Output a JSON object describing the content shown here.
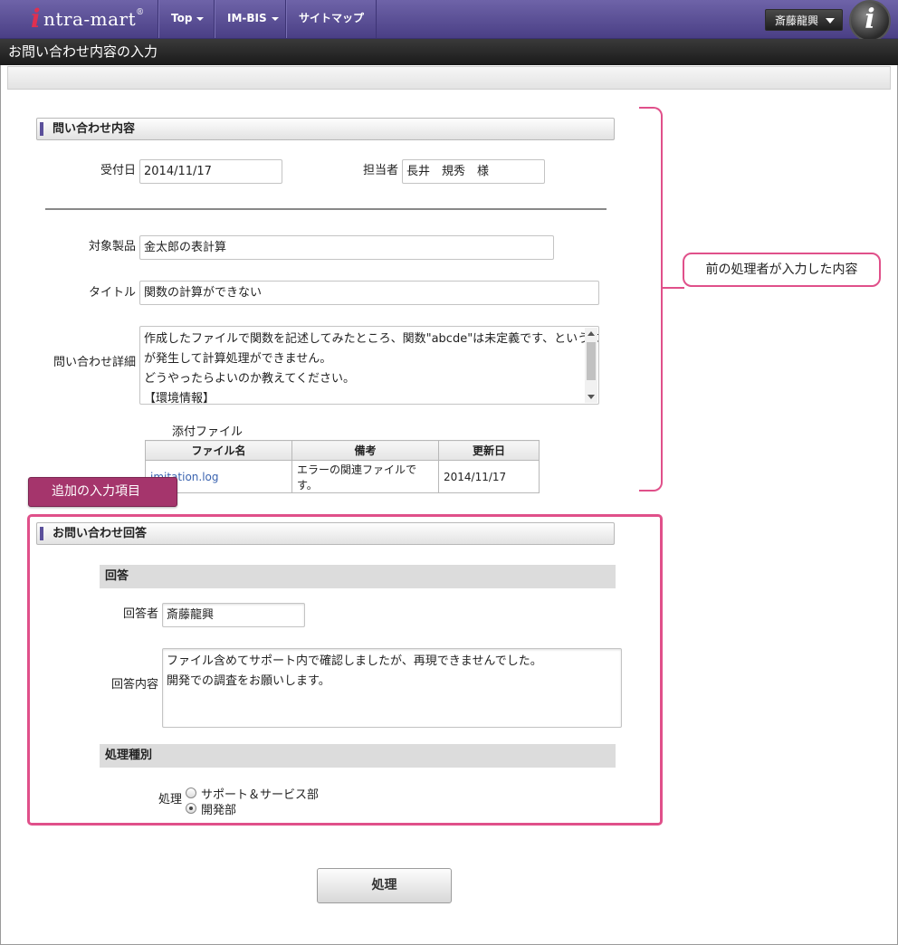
{
  "app": {
    "logo_prefix": "i",
    "logo_text": "ntra-mart",
    "logo_reg": "®",
    "nav": [
      {
        "label": "Top",
        "dropdown": true
      },
      {
        "label": "IM-BIS",
        "dropdown": true
      },
      {
        "label": "サイトマップ",
        "dropdown": false
      }
    ],
    "user": "斎藤龍興",
    "avatar_letter": "i"
  },
  "page": {
    "title": "お問い合わせ内容の入力"
  },
  "inquiry": {
    "heading": "問い合わせ内容",
    "received_label": "受付日",
    "received_value": "2014/11/17",
    "person_label": "担当者",
    "person_value": "長井　規秀　様",
    "product_label": "対象製品",
    "product_value": "金太郎の表計算",
    "title_label": "タイトル",
    "title_value": "関数の計算ができない",
    "detail_label": "問い合わせ詳細",
    "detail_lines": [
      "作成したファイルで関数を記述してみたところ、関数\"abcde\"は未定義です、というエラー",
      "が発生して計算処理ができません。",
      "どうやったらよいのか教えてください。",
      "【環境情報】"
    ],
    "attach_label": "添付ファイル",
    "attach_headers": [
      "ファイル名",
      "備考",
      "更新日"
    ],
    "attach_rows": [
      {
        "name": "imitation.log",
        "note": "エラーの関連ファイルです。",
        "date": "2014/11/17"
      }
    ]
  },
  "callouts": {
    "previous": "前の処理者が入力した内容",
    "added": "追加の入力項目"
  },
  "answer": {
    "heading": "お問い合わせ回答",
    "sub_answer": "回答",
    "answerer_label": "回答者",
    "answerer_value": "斎藤龍興",
    "content_label": "回答内容",
    "content_lines": [
      "ファイル含めてサポート内で確認しましたが、再現できませんでした。",
      "開発での調査をお願いします。"
    ],
    "sub_process": "処理種別",
    "process_label": "処理",
    "options": [
      {
        "label": "サポート＆サービス部",
        "selected": false
      },
      {
        "label": "開発部",
        "selected": true
      }
    ]
  },
  "actions": {
    "submit": "処理"
  },
  "colors": {
    "nav_purple": "#5a4f9a",
    "callout_pink": "#e0508a",
    "badge_magenta": "#a5356c",
    "link_blue": "#3b64b0"
  }
}
